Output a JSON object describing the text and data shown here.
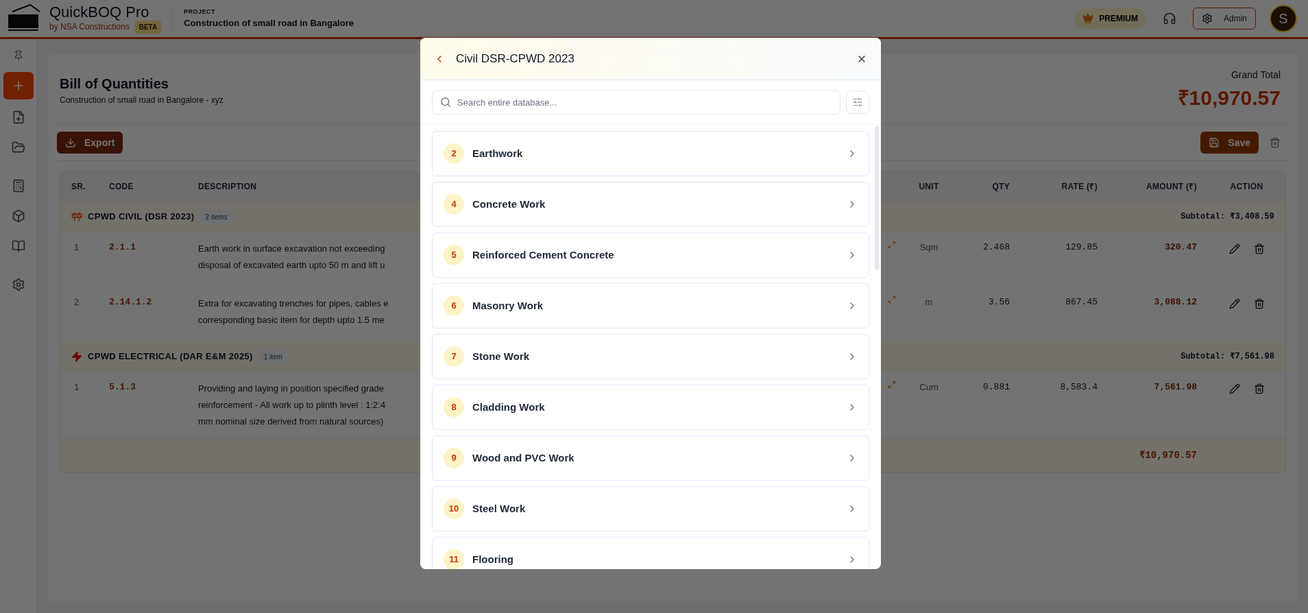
{
  "header": {
    "app_name": "QuickBOQ Pro",
    "byline": "by NSA Constructions",
    "badge": "BETA",
    "project_label": "PROJECT",
    "project_name": "Construction of small road in Bangalore",
    "plan_badge": "PREMIUM",
    "admin_label": "Admin",
    "avatar_initial": "S"
  },
  "page": {
    "title": "Bill of Quantities",
    "subtitle": "Construction of small road in Bangalore - xyz",
    "grand_total_label": "Grand Total",
    "grand_total": "₹10,970.57",
    "export_label": "Export",
    "save_label": "Save"
  },
  "table": {
    "columns": [
      "SR.",
      "CODE",
      "DESCRIPTION",
      "UNIT",
      "QTY",
      "RATE (₹)",
      "AMOUNT (₹)",
      "ACTION"
    ],
    "groups": [
      {
        "kind": "civil",
        "name": "CPWD CIVIL (DSR 2023)",
        "count": "2 items",
        "subtotal": "Subtotal: ₹3,408.59",
        "rows": [
          {
            "sr": "1",
            "code": "2.1.1",
            "description_lines": [
              "Earth work in surface excavation not exceeding",
              "disposal of excavated earth upto 50 m and lift u"
            ],
            "unit": "Sqm",
            "qty": "2.468",
            "rate": "129.85",
            "amount": "320.47"
          },
          {
            "sr": "2",
            "code": "2.14.1.2",
            "description_lines": [
              "Extra for excavating trenches for pipes, cables e",
              "corresponding basic item for depth upto 1.5 me"
            ],
            "unit": "m",
            "qty": "3.56",
            "rate": "867.45",
            "amount": "3,088.12"
          }
        ]
      },
      {
        "kind": "electrical",
        "name": "CPWD ELECTRICAL (DAR E&M 2025)",
        "count": "1 item",
        "subtotal": "Subtotal: ₹7,561.98",
        "rows": [
          {
            "sr": "1",
            "code": "5.1.3",
            "description_lines": [
              "Providing and laying in position specified grade",
              "reinforcement - All work up to plinth level : 1:2:4",
              "mm nominal size derived from natural sources)"
            ],
            "unit": "Cum",
            "qty": "0.881",
            "rate": "8,583.4",
            "amount": "7,561.98"
          }
        ]
      }
    ],
    "total": "₹10,970.57"
  },
  "modal": {
    "title": "Civil DSR-CPWD 2023",
    "search_placeholder": "Search entire database...",
    "categories": [
      {
        "number": "2",
        "name": "Earthwork"
      },
      {
        "number": "4",
        "name": "Concrete Work"
      },
      {
        "number": "5",
        "name": "Reinforced Cement Concrete"
      },
      {
        "number": "6",
        "name": "Masonry Work"
      },
      {
        "number": "7",
        "name": "Stone Work"
      },
      {
        "number": "8",
        "name": "Cladding Work"
      },
      {
        "number": "9",
        "name": "Wood and PVC Work"
      },
      {
        "number": "10",
        "name": "Steel Work"
      },
      {
        "number": "11",
        "name": "Flooring"
      }
    ]
  }
}
